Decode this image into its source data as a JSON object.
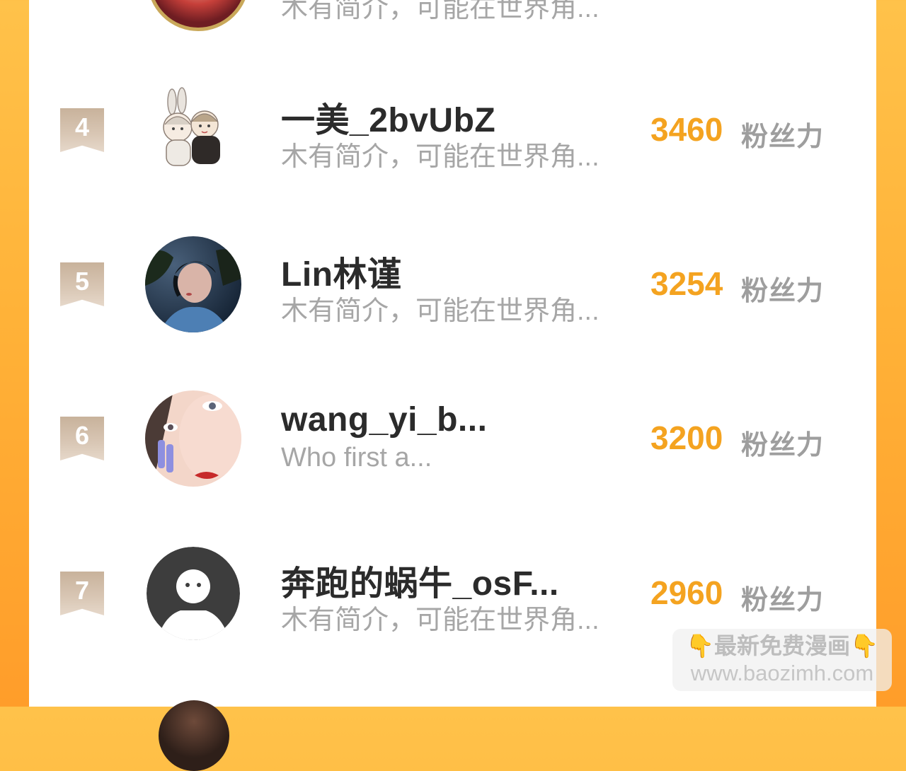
{
  "top_partial": {
    "bio": "木有简介，可能在世界角..."
  },
  "entries": [
    {
      "rank": "4",
      "name": "一美_2bvUbZ",
      "bio": "木有简介，可能在世界角...",
      "score": "3460",
      "score_unit": "粉丝力",
      "avatar_icon": "cartoon-couple-avatar"
    },
    {
      "rank": "5",
      "name": "Lin林谨",
      "bio": "木有简介，可能在世界角...",
      "score": "3254",
      "score_unit": "粉丝力",
      "avatar_icon": "photo-avatar"
    },
    {
      "rank": "6",
      "name": "wang_yi_b...",
      "bio": "Who first a...",
      "score": "3200",
      "score_unit": "粉丝力",
      "avatar_icon": "photo-avatar"
    },
    {
      "rank": "7",
      "name": "奔跑的蜗牛_osF...",
      "bio": "木有简介，可能在世界角...",
      "score": "2960",
      "score_unit": "粉丝力",
      "avatar_icon": "default-user-avatar"
    }
  ],
  "watermark": {
    "line1_hand_left": "👇",
    "line1_text": "最新免费漫画",
    "line1_hand_right": "👇",
    "line2": "www.baozimh.com"
  },
  "colors": {
    "accent": "#f4a320",
    "background": "#ffb238",
    "rank_badge": "#d2bfac",
    "name": "#2b2b2b",
    "muted": "#a6a6a6"
  }
}
